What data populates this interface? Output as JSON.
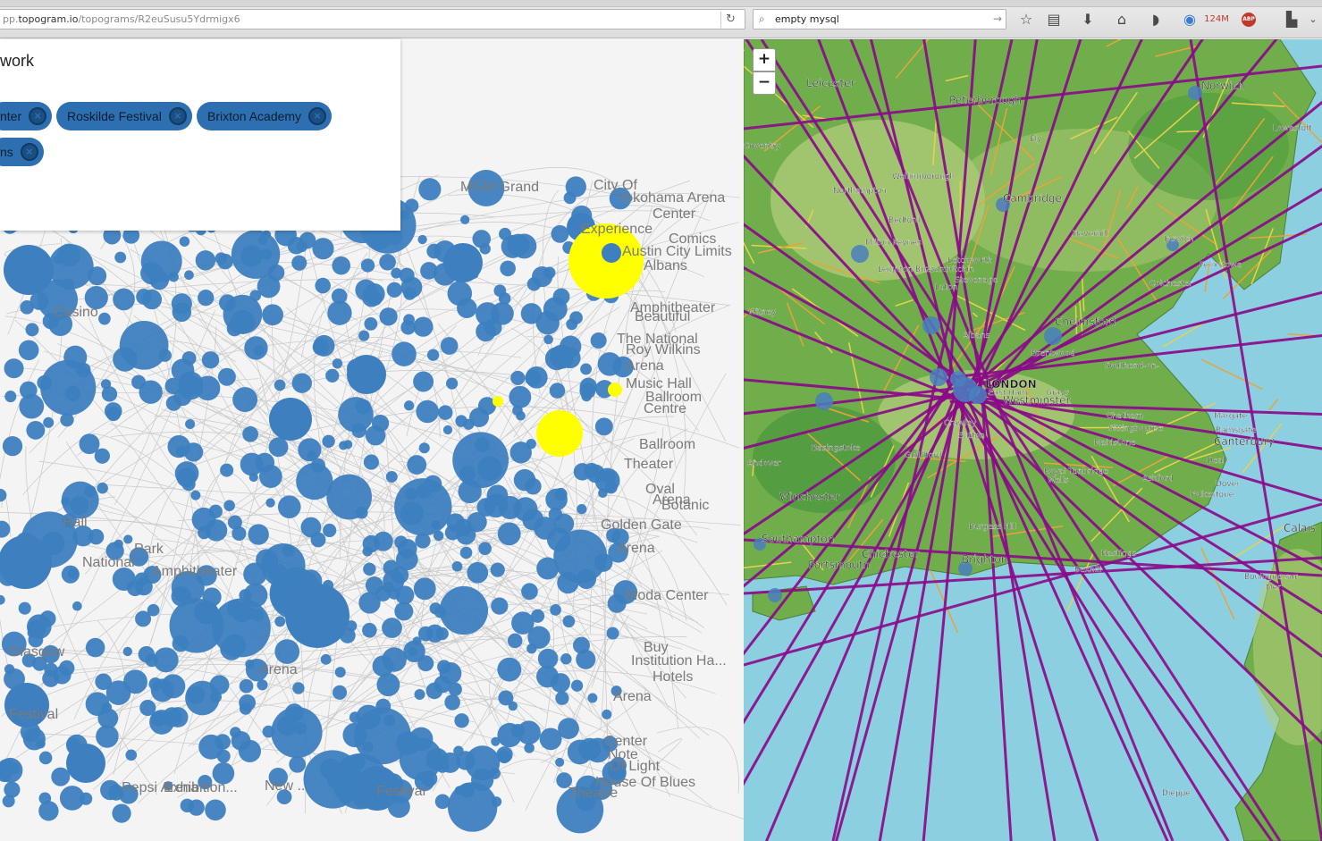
{
  "browser": {
    "url_prefix": "pp.",
    "url_host": "topogram.io",
    "url_path": "/topograms/R2euSusu5Ydrmigx6",
    "search_value": "empty mysql",
    "memory_badge": "124M",
    "adblock_label": "ABP",
    "icons": [
      "reload-icon",
      "search-icon",
      "bookmark-star-icon",
      "reading-list-icon",
      "download-icon",
      "home-icon",
      "pocket-icon",
      "extension-icon",
      "adblock-icon",
      "menu-icon"
    ]
  },
  "panel": {
    "title": "work",
    "chips": [
      {
        "label": "nter"
      },
      {
        "label": "Roskilde Festival"
      },
      {
        "label": "Brixton Academy"
      },
      {
        "label": "ns"
      }
    ]
  },
  "graph": {
    "node_color": "#3d7fbf",
    "highlight_color": "#ffff00",
    "edge_color": "#c8c8c8",
    "label_color": "#7a7a7a",
    "visible_labels": [
      "MGM Grand",
      "City Of",
      "Yokohama Arena",
      "Center",
      "Experience",
      "Austin City Limits",
      "Comics",
      "Albans",
      "Amphitheater",
      "Ballroom",
      "Beautiful",
      "The National",
      "Roy Wilkins",
      "Arena",
      "Music Hall",
      "Centre",
      "Ballroom",
      "Theater",
      "Oval",
      "Arena",
      "Botanic",
      "Golden Gate",
      "Arena",
      "Moda Center",
      "Buy",
      "Institution Ha...",
      "Hotels",
      "Arena",
      "Center",
      "Note",
      "Of Light",
      "House Of Blues",
      "Theatre",
      "Festival",
      "New ...",
      "Pepsi Arena",
      "Exhibition...",
      "Casino",
      "Glasgow",
      "Festival",
      "National",
      "Park",
      "Hall",
      "Amphitheater",
      "Arena"
    ]
  },
  "map": {
    "zoom_in": "+",
    "zoom_out": "−",
    "sea_color": "#8ccfe0",
    "land_color": "#6fae4a",
    "route_color": "#8b0a8b",
    "places": [
      "Leicester",
      "Peterborough",
      "Norwich",
      "Lowestoft",
      "Coventry",
      "Cambridge",
      "Haverhill",
      "Ipswich",
      "Felixstowe",
      "Bedford",
      "Milton Keynes",
      "Letchworth",
      "Hitchin",
      "Stevenage",
      "Colchester",
      "Witney",
      "Chelmsford",
      "Albans",
      "Brentwood",
      "Southend-on-",
      "LONDON",
      "East Ham",
      "Grays",
      "Westminster",
      "Margate",
      "Ramsgate",
      "Sittingbourne",
      "Canterbury",
      "Deal",
      "Basingstoke",
      "Guildford",
      "Sutton",
      "Andover",
      "Royal Tunbridge",
      "Wells",
      "Ashford",
      "Dover",
      "Folkestone",
      "Winchester",
      "Calais",
      "Southampton",
      "Chichester",
      "Brighton",
      "Burgess Hill",
      "Hastings",
      "Portsmouth",
      "Bexhill",
      "Boulogne-sur-",
      "Mer",
      "Dieppe",
      "Ely",
      "Northampton",
      "Wellingborough",
      "Leighton Buzzard",
      "Luton",
      "Maidstone",
      "Chatham",
      "Crawley"
    ]
  }
}
